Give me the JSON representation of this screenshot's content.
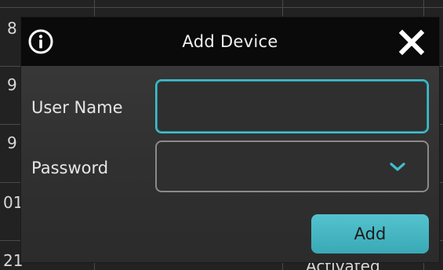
{
  "dialog": {
    "title": "Add Device",
    "info_icon": "info-circle-icon",
    "close_icon": "close-x-icon"
  },
  "form": {
    "username": {
      "label": "User Name",
      "value": ""
    },
    "password": {
      "label": "Password",
      "value": "",
      "dropdown_icon": "chevron-down-icon"
    },
    "add_label": "Add"
  },
  "background_table": {
    "row_fragments": [
      "8",
      "9",
      "9",
      "01",
      "21"
    ],
    "status_fragment": "Activated"
  },
  "colors": {
    "accent": "#3fbfcc",
    "titlebar": "#0a0a0a",
    "dialog_bg": "#333333",
    "button": "#45b5c2"
  }
}
